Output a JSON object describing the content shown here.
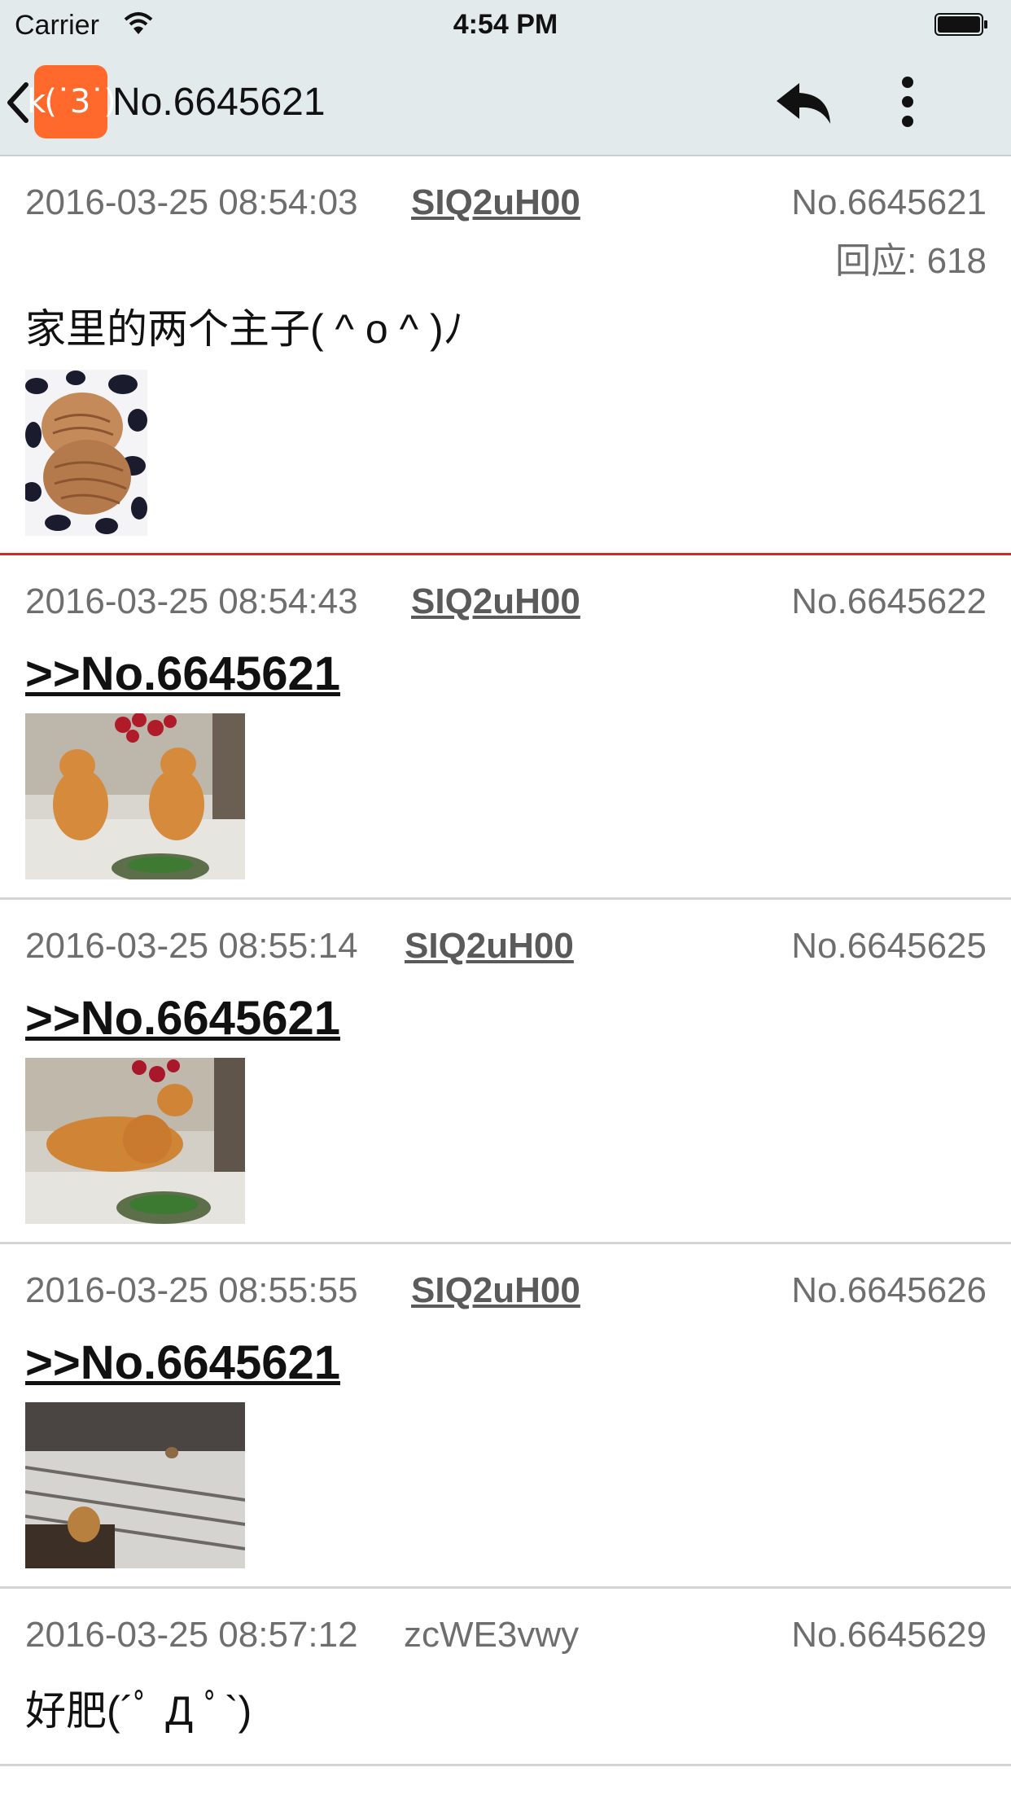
{
  "status_bar": {
    "carrier": "Carrier",
    "time": "4:54 PM"
  },
  "nav": {
    "logo_text": "k(˙3˙)",
    "title": "No.6645621"
  },
  "posts": [
    {
      "date": "2016-03-25 08:54:03",
      "user": "SIQ2uH00",
      "no": "No.6645621",
      "replies": "回应: 618",
      "text": "家里的两个主子( ^ o ^ )ﾉ",
      "image": "two-cats-sleeping-on-blanket"
    },
    {
      "date": "2016-03-25 08:54:43",
      "user": "SIQ2uH00",
      "no": "No.6645622",
      "quote": ">>No.6645621",
      "image": "two-cats-sitting-on-table"
    },
    {
      "date": "2016-03-25 08:55:14",
      "user": "SIQ2uH00",
      "no": "No.6645625",
      "quote": ">>No.6645621",
      "image": "cats-on-table-with-flowers"
    },
    {
      "date": "2016-03-25 08:55:55",
      "user": "SIQ2uH00",
      "no": "No.6645626",
      "quote": ">>No.6645621",
      "image": "cats-on-staircase"
    },
    {
      "date": "2016-03-25 08:57:12",
      "user": "zcWE3vwy",
      "no": "No.6645629",
      "text": "好肥(´ﾟ Д ﾟ`)"
    }
  ],
  "colors": {
    "nav_background": "#e3eaeb",
    "logo_orange": "#ff6a2c",
    "op_separator": "#d6262c",
    "separator": "#d4d4d4",
    "meta_text": "#6e6e6e"
  }
}
